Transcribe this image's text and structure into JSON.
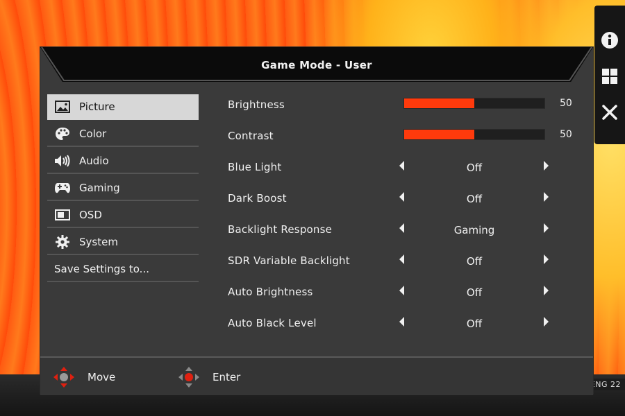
{
  "osd": {
    "title": "Game Mode - User",
    "menu": [
      {
        "label": "Picture",
        "icon": "picture-icon",
        "selected": true
      },
      {
        "label": "Color",
        "icon": "palette-icon",
        "selected": false
      },
      {
        "label": "Audio",
        "icon": "speaker-icon",
        "selected": false
      },
      {
        "label": "Gaming",
        "icon": "gamepad-icon",
        "selected": false
      },
      {
        "label": "OSD",
        "icon": "screen-icon",
        "selected": false
      },
      {
        "label": "System",
        "icon": "gear-icon",
        "selected": false
      },
      {
        "label": "Save Settings to...",
        "icon": "",
        "selected": false
      }
    ],
    "settings": {
      "brightness": {
        "label": "Brightness",
        "value": "50",
        "level": 0.5
      },
      "contrast": {
        "label": "Contrast",
        "value": "50",
        "level": 0.5
      },
      "blue_light": {
        "label": "Blue Light",
        "value": "Off"
      },
      "dark_boost": {
        "label": "Dark Boost",
        "value": "Off"
      },
      "backlight_response": {
        "label": "Backlight Response",
        "value": "Gaming"
      },
      "sdr_variable_backlight": {
        "label": "SDR Variable Backlight",
        "value": "Off"
      },
      "auto_brightness": {
        "label": "Auto Brightness",
        "value": "Off"
      },
      "auto_black_level": {
        "label": "Auto Black Level",
        "value": "Off"
      }
    },
    "footer": {
      "move_label": "Move",
      "enter_label": "Enter"
    }
  },
  "quick_panel": {
    "icons": [
      "info-icon",
      "grid-icon",
      "close-icon"
    ]
  },
  "taskbar": {
    "text": "ENG  22"
  },
  "colors": {
    "accent": "#ff3a0c",
    "panel": "#3a3a3a",
    "header": "#0b0b0b",
    "selected_item": "#d7d7d7"
  }
}
